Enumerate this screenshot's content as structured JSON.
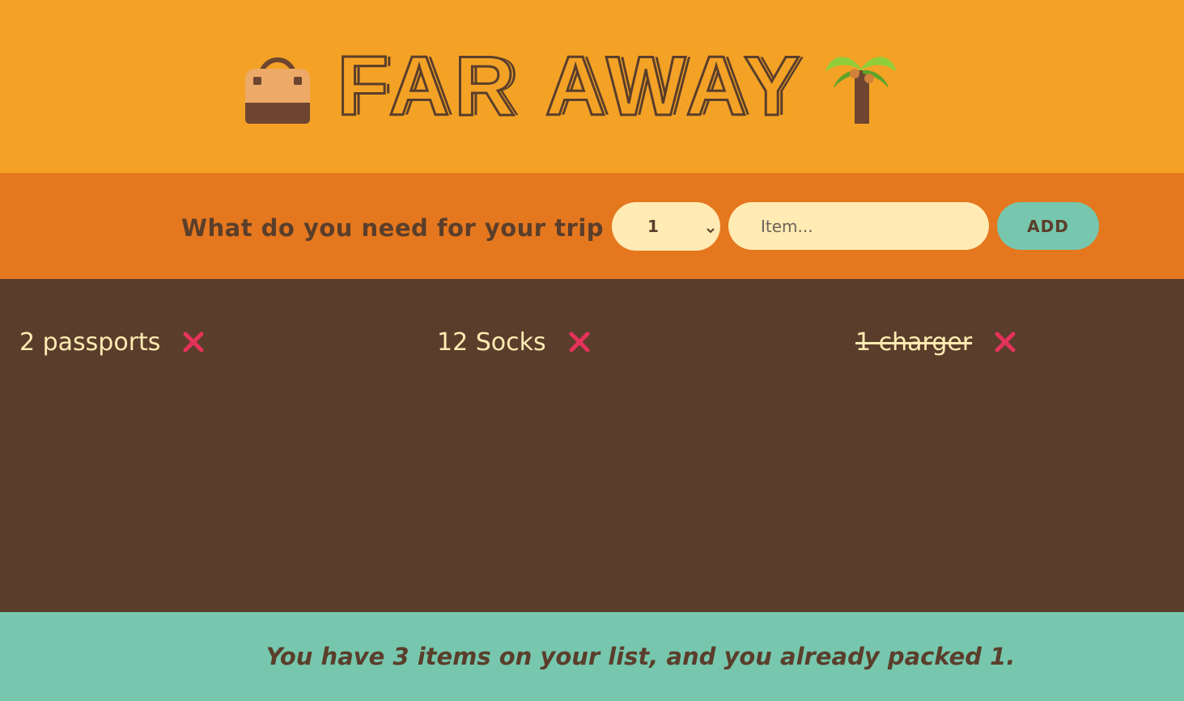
{
  "header": {
    "title": "FAR AWAY",
    "left_icon": "handbag-icon",
    "right_icon": "palm-tree-icon"
  },
  "form": {
    "question": "What do you need for your trip",
    "emoji": "star-struck-face-icon",
    "quantity_value": "1",
    "item_placeholder": "Item...",
    "add_label": "ADD"
  },
  "items": [
    {
      "text": "2 passports",
      "packed": false
    },
    {
      "text": "12 Socks",
      "packed": false
    },
    {
      "text": "1 charger",
      "packed": true
    }
  ],
  "stats": {
    "text": "You have 3 items on your list, and you already packed 1."
  },
  "colors": {
    "header_bg": "#f4a226",
    "form_bg": "#e5771e",
    "list_bg": "#5a3e2b",
    "footer_bg": "#76c7ad",
    "text_dark": "#5a3e2b",
    "cream": "#ffebb3",
    "remove": "#e5325a"
  }
}
